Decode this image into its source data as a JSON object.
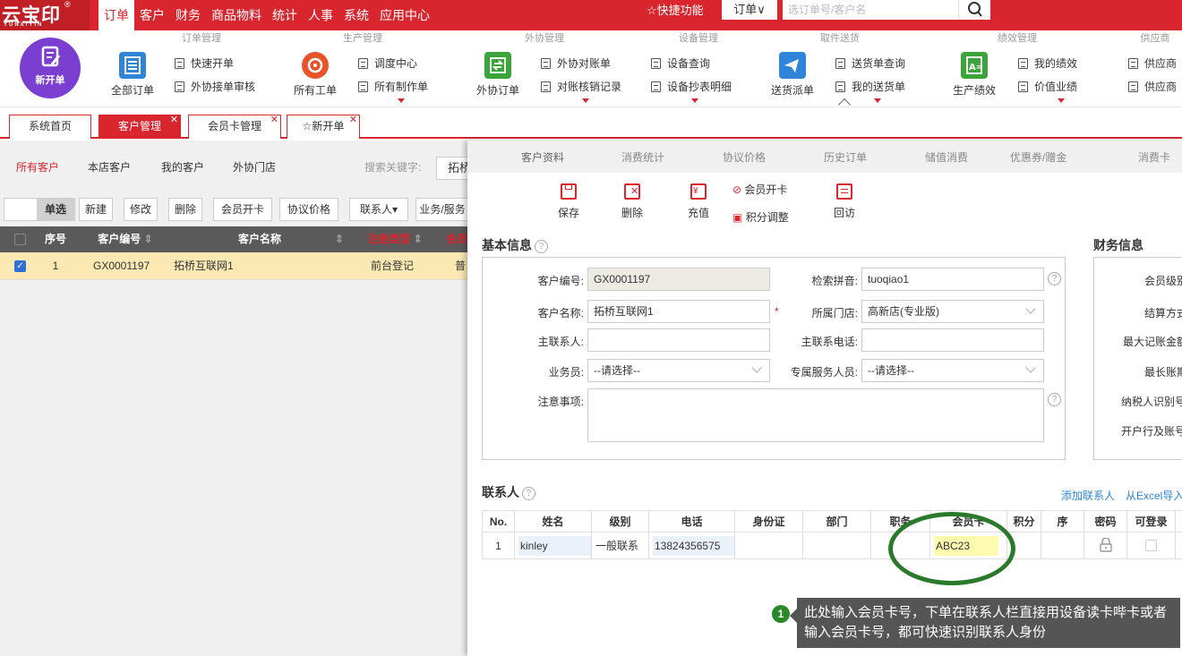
{
  "app": {
    "logo": "云宝印",
    "logo_sub": "YUNXIYIN",
    "logo_reg": "®"
  },
  "top_menu": [
    "订单",
    "客户",
    "财务",
    "商品物料",
    "统计",
    "人事",
    "系统",
    "应用中心"
  ],
  "topbar": {
    "quick": "快捷功能",
    "order_select": "订单",
    "search_placeholder": "选订单号/客户名"
  },
  "ribbon": {
    "groups": [
      "订单管理",
      "生产管理",
      "外协管理",
      "设备管理",
      "取件送货",
      "绩效管理",
      "供应商"
    ],
    "new_order": "新开单",
    "all_orders": "全部订单",
    "quick_order": "快速开单",
    "outsource_review": "外协接单审核",
    "all_workorders": "所有工单",
    "dispatch_center": "调度中心",
    "all_production": "所有制作单",
    "outsource_order": "外协订单",
    "outsource_reconcile": "外协对账单",
    "reconcile_records": "对账核销记录",
    "device_query": "设备查询",
    "device_reading": "设备抄表明细",
    "delivery_dispatch": "送货派单",
    "delivery_query": "送货单查询",
    "my_delivery": "我的送货单",
    "production_perf": "生产绩效",
    "my_perf": "我的绩效",
    "value_perf": "价值业绩",
    "supplier_1": "供应商",
    "supplier_2": "供应商"
  },
  "tabs": [
    {
      "label": "系统首页"
    },
    {
      "label": "客户管理"
    },
    {
      "label": "会员卡管理"
    },
    {
      "label": "新开单"
    }
  ],
  "customer_list": {
    "subnav": [
      "所有客户",
      "本店客户",
      "我的客户",
      "外协门店"
    ],
    "search_label": "搜索关键字:",
    "search_value": "拓桥",
    "toolbar": [
      "单选",
      "新建",
      "修改",
      "删除",
      "会员开卡",
      "协议价格",
      "联系人▾",
      "业务/服务"
    ],
    "columns": [
      "序号",
      "客户编号",
      "客户名称",
      "注册类型",
      "会员"
    ],
    "rows": [
      {
        "no": "1",
        "code": "GX0001197",
        "name": "拓桥互联网1",
        "reg_type": "前台登记",
        "member": "普"
      }
    ]
  },
  "detail": {
    "tabs": [
      "客户资料",
      "消费统计",
      "协议价格",
      "历史订单",
      "储值消费",
      "优惠券/赠金",
      "消费卡"
    ],
    "toolbar": {
      "save": "保存",
      "delete": "删除",
      "recharge": "充值",
      "open_card": "会员开卡",
      "points_adjust": "积分调整",
      "revisit": "回访"
    },
    "basic_title": "基本信息",
    "finance_title": "财务信息",
    "fields": {
      "code_label": "客户编号:",
      "code_value": "GX0001197",
      "pinyin_label": "检索拼音:",
      "pinyin_value": "tuoqiao1",
      "name_label": "客户名称:",
      "name_value": "拓桥互联网1",
      "required_mark": "*",
      "store_label": "所属门店:",
      "store_value": "高新店(专业版)",
      "contact_label": "主联系人:",
      "phone_label": "主联系电话:",
      "sales_label": "业务员:",
      "sales_value": "--请选择--",
      "service_label": "专属服务人员:",
      "service_value": "--请选择--",
      "notes_label": "注意事项:"
    },
    "finance_fields": [
      "会员级别",
      "结算方式",
      "最大记账金额",
      "最长账期",
      "纳税人识别号",
      "开户行及账号"
    ],
    "contacts_title": "联系人",
    "add_contact": "添加联系人",
    "import_excel": "从Excel导入",
    "contact_columns": [
      "No.",
      "姓名",
      "级别",
      "电话",
      "身份证",
      "部门",
      "职务",
      "会员卡",
      "积分",
      "序",
      "密码",
      "可登录"
    ],
    "contact_rows": [
      {
        "no": "1",
        "name": "kinley",
        "level": "一般联系",
        "phone": "13824356575",
        "card": "ABC23"
      }
    ]
  },
  "callout": {
    "badge": "1",
    "text": "此处输入会员卡号，下单在联系人栏直接用设备读卡哔卡或者输入会员卡号，都可快速识别联系人身份"
  },
  "colors": {
    "brand_red": "#d9262e",
    "selected_row": "#fbe9b3",
    "highlight_input": "#fefbb0",
    "annotation_green": "#2b7a2b"
  }
}
